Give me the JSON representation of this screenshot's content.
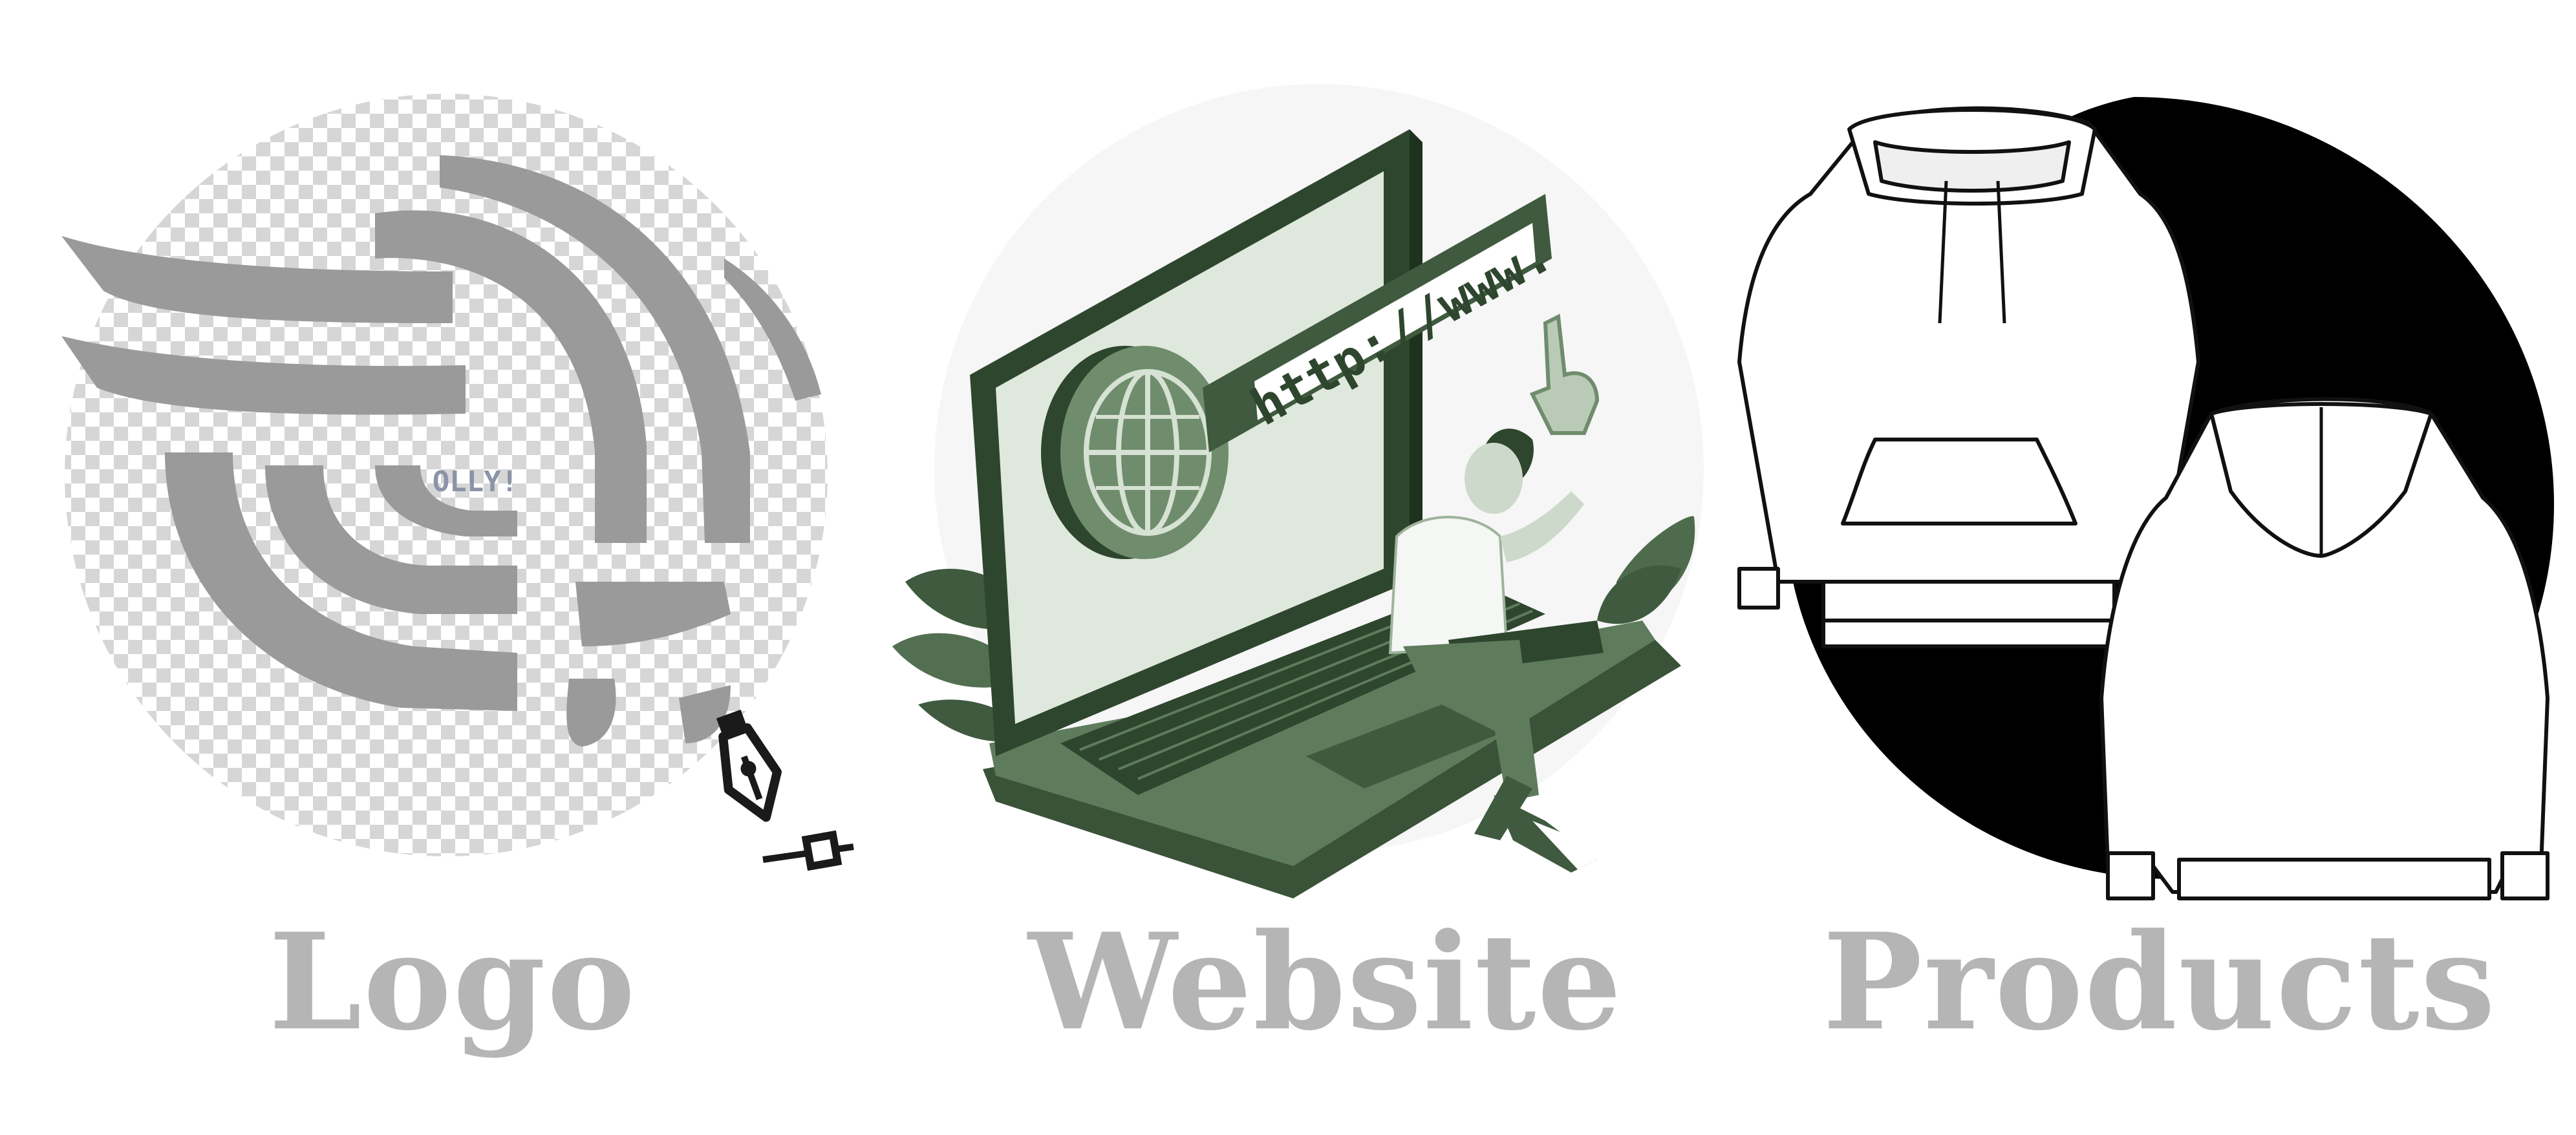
{
  "panels": [
    {
      "caption": "Logo",
      "illustration": "logo-design-on-transparent-grid"
    },
    {
      "caption": "Website",
      "illustration": "person-with-laptop-and-url-bar",
      "url_text": "http://www."
    },
    {
      "caption": "Products",
      "illustration": "hoodie-front-and-back-sketch"
    }
  ],
  "logo_mark_text": "OLLY!",
  "colors": {
    "caption_gray": "#b5b5b5",
    "logo_gray": "#9a9a9a",
    "website_green": "#4f6b4d",
    "website_light_green": "#cfdccd",
    "products_black": "#000000"
  }
}
